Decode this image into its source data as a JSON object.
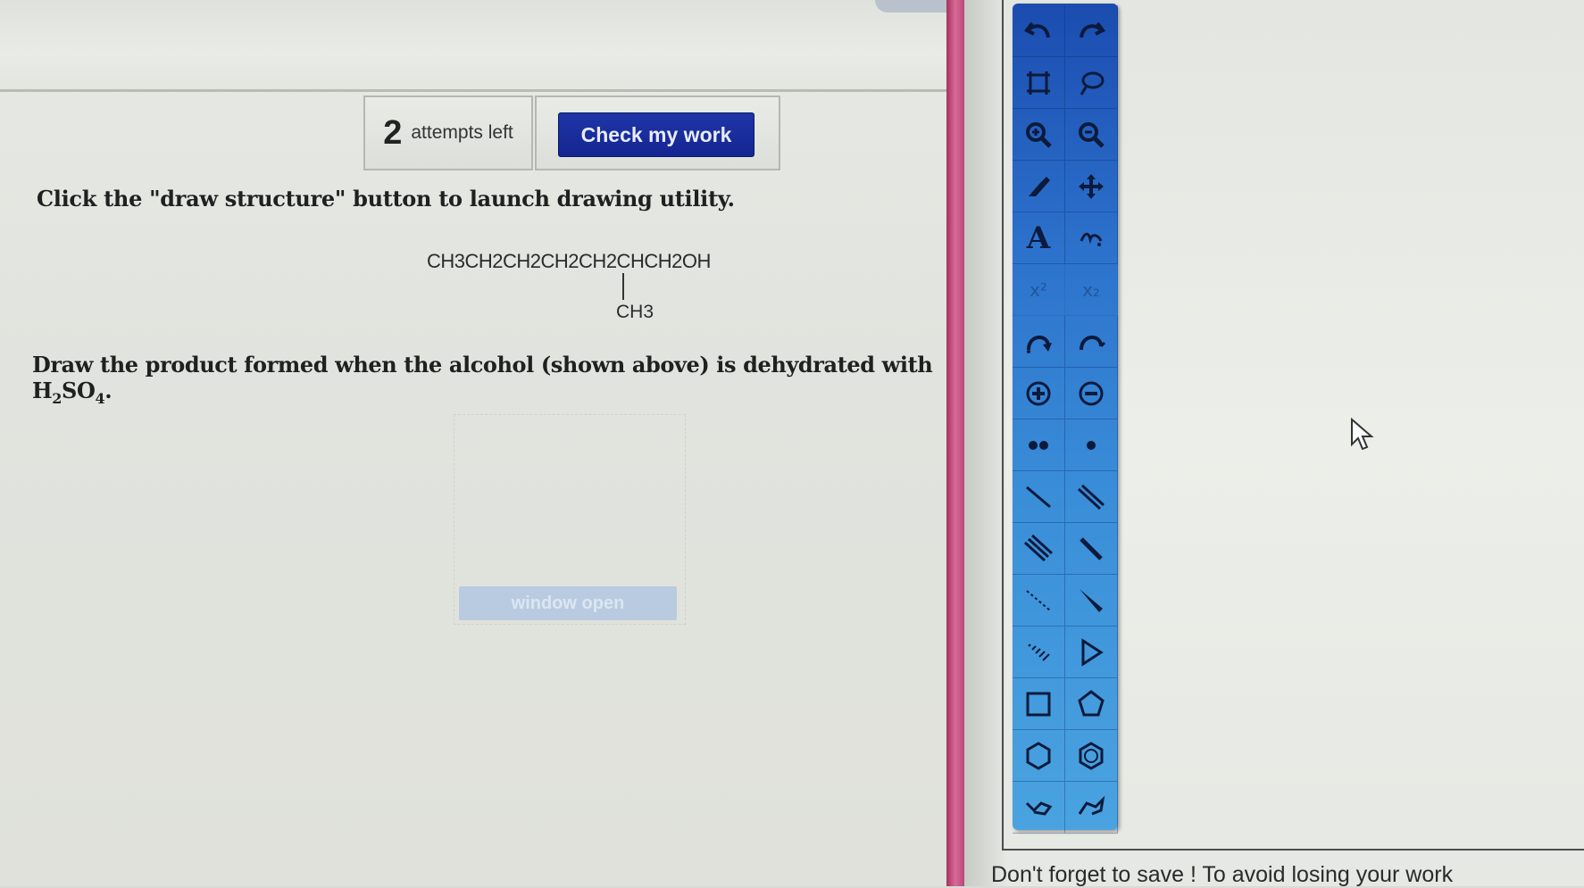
{
  "header": {
    "attempts_count": "2",
    "attempts_label": "attempts left",
    "check_button_label": "Check my work"
  },
  "instructions": {
    "text": "Click the \"draw structure\" button to launch drawing utility."
  },
  "structure": {
    "main_chain": "CH3CH2CH2CH2CH2CHCH2OH",
    "branch": "CH3"
  },
  "question": {
    "text_before": "Draw the product formed when the alcohol (shown above) is dehydrated with H",
    "sub1": "2",
    "so": "SO",
    "sub2": "4",
    "end": "."
  },
  "answer": {
    "button_label": "window open"
  },
  "toolbar": {
    "tools": [
      "undo-icon",
      "redo-icon",
      "marquee-select-icon",
      "lasso-select-icon",
      "zoom-in-icon",
      "zoom-out-icon",
      "eraser-icon",
      "move-icon",
      "text-icon",
      "template-icon",
      "superscript-icon",
      "subscript-icon",
      "curved-arrow-full-icon",
      "curved-arrow-half-icon",
      "positive-charge-icon",
      "negative-charge-icon",
      "lone-pair-icon",
      "radical-icon",
      "single-bond-icon",
      "double-bond-icon",
      "triple-bond-icon",
      "bold-bond-icon",
      "dashed-bond-icon",
      "wedge-bond-icon",
      "hash-bond-icon",
      "arrow-icon",
      "square-icon",
      "pentagon-icon",
      "hexagon-icon",
      "benzene-icon",
      "chair-left-icon",
      "chair-right-icon"
    ],
    "text_tool_label": "A",
    "superscript_label": "x²",
    "subscript_label": "x₂"
  },
  "footer": {
    "save_reminder": "Don't forget to save ! To avoid losing your work"
  },
  "colors": {
    "accent_button": "#1a2f9e",
    "toolbar_top": "#1b4cb0",
    "toolbar_bottom": "#4aa3e0",
    "divider_pink": "#c9578a"
  }
}
